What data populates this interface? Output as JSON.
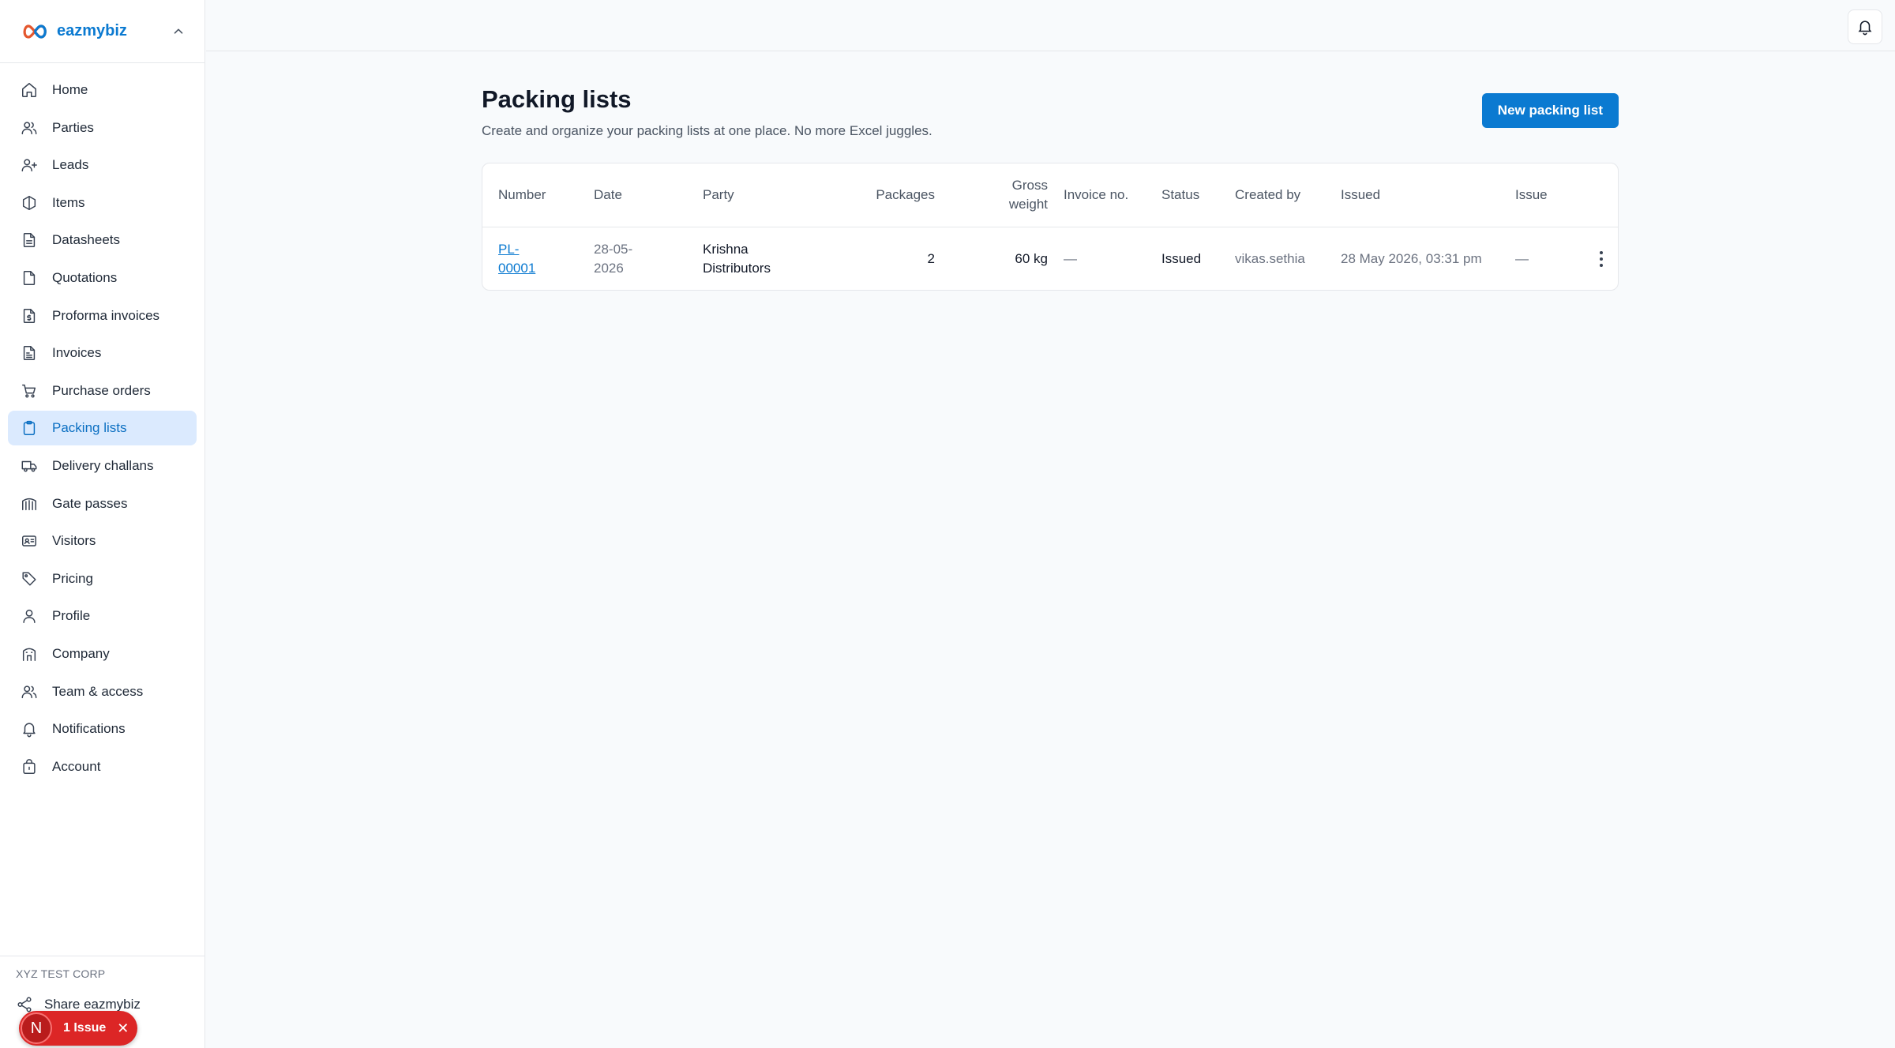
{
  "brand": {
    "name": "eazmybiz",
    "accent": "#0b7ad1"
  },
  "sidebar": {
    "items": [
      {
        "label": "Home",
        "icon": "home-icon"
      },
      {
        "label": "Parties",
        "icon": "users-icon"
      },
      {
        "label": "Leads",
        "icon": "user-plus-icon"
      },
      {
        "label": "Items",
        "icon": "box-icon"
      },
      {
        "label": "Datasheets",
        "icon": "document-icon"
      },
      {
        "label": "Quotations",
        "icon": "file-icon"
      },
      {
        "label": "Proforma invoices",
        "icon": "file-dollar-icon"
      },
      {
        "label": "Invoices",
        "icon": "file-text-icon"
      },
      {
        "label": "Purchase orders",
        "icon": "cart-icon"
      },
      {
        "label": "Packing lists",
        "icon": "clipboard-icon",
        "active": true
      },
      {
        "label": "Delivery challans",
        "icon": "truck-icon"
      },
      {
        "label": "Gate passes",
        "icon": "gate-icon"
      },
      {
        "label": "Visitors",
        "icon": "id-card-icon"
      },
      {
        "label": "Pricing",
        "icon": "tag-icon"
      },
      {
        "label": "Profile",
        "icon": "user-icon"
      },
      {
        "label": "Company",
        "icon": "building-icon"
      },
      {
        "label": "Team & access",
        "icon": "team-icon"
      },
      {
        "label": "Notifications",
        "icon": "bell-icon"
      },
      {
        "label": "Account",
        "icon": "lock-icon"
      }
    ],
    "footer": {
      "org": "XYZ TEST CORP",
      "share_label": "Share eazmybiz"
    }
  },
  "issue_badge": {
    "avatar": "N",
    "label": "1 Issue"
  },
  "page": {
    "title": "Packing lists",
    "subtitle": "Create and organize your packing lists at one place. No more Excel juggles.",
    "new_button": "New packing list"
  },
  "table": {
    "headers": {
      "number": "Number",
      "date": "Date",
      "party": "Party",
      "packages": "Packages",
      "gross_weight": "Gross weight",
      "invoice_no": "Invoice no.",
      "status": "Status",
      "created_by": "Created by",
      "issued": "Issued",
      "issue": "Issue"
    },
    "rows": [
      {
        "number": "PL-00001",
        "date": "28-05-2026",
        "party": "Krishna Distributors",
        "packages": "2",
        "gross_weight": "60 kg",
        "invoice_no": "—",
        "status": "Issued",
        "created_by": "vikas.sethia",
        "issued": "28 May 2026, 03:31 pm",
        "issue": "—"
      }
    ]
  }
}
